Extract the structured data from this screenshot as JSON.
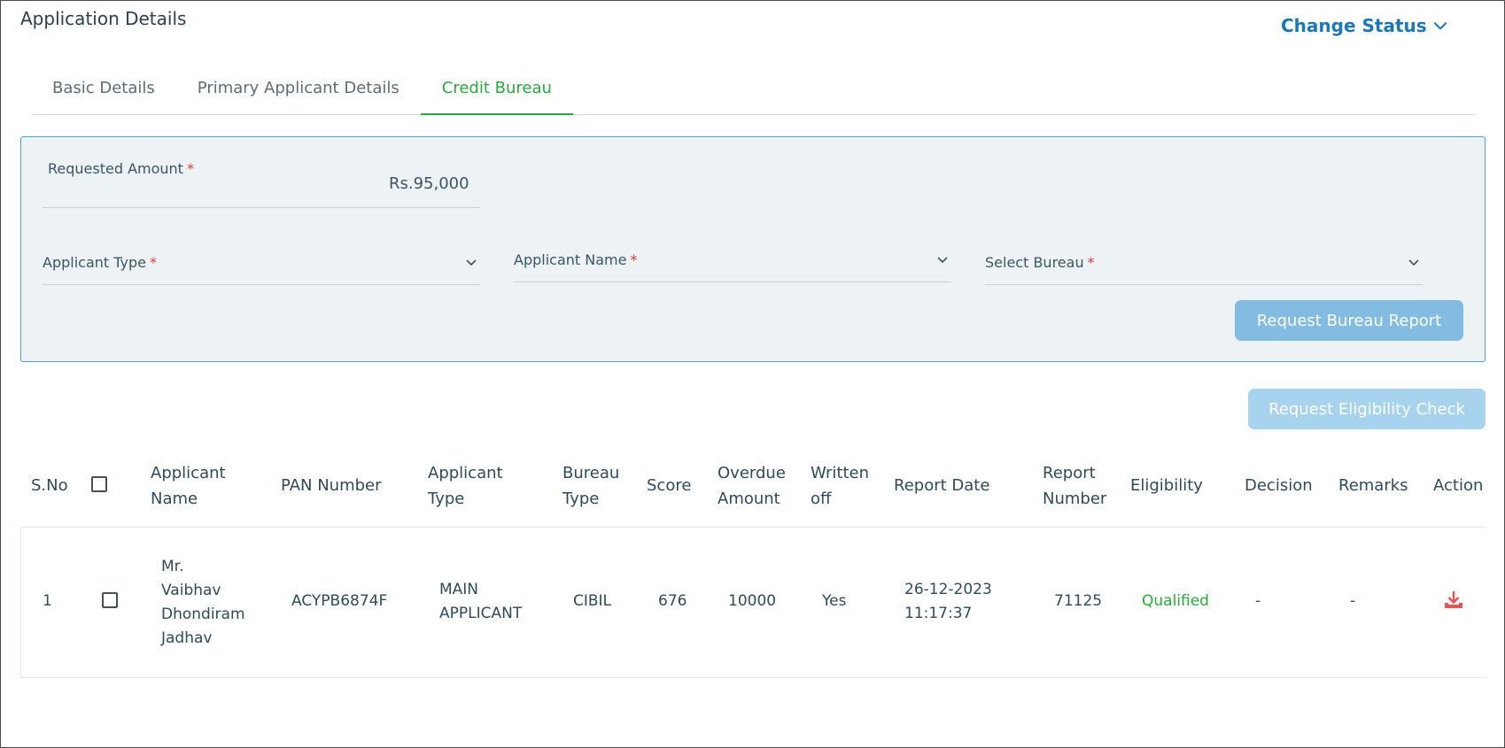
{
  "page": {
    "title": "Application Details",
    "change_status": "Change Status"
  },
  "tabs": [
    {
      "label": "Basic Details",
      "active": false
    },
    {
      "label": "Primary Applicant Details",
      "active": false
    },
    {
      "label": "Credit Bureau",
      "active": true
    }
  ],
  "form": {
    "requested_amount": {
      "label": "Requested Amount",
      "required_mark": "*",
      "value": "Rs.95,000"
    },
    "applicant_type": {
      "label": "Applicant Type",
      "required_mark": "*",
      "value": ""
    },
    "applicant_name": {
      "label": "Applicant Name",
      "required_mark": "*",
      "value": ""
    },
    "select_bureau": {
      "label": "Select Bureau",
      "required_mark": "*",
      "value": ""
    },
    "request_bureau_button": "Request Bureau Report"
  },
  "eligibility_button": "Request Eligibility Check",
  "table": {
    "headers": {
      "sno": "S.No",
      "applicant_name": [
        "Applicant",
        "Name"
      ],
      "pan": "PAN Number",
      "applicant_type": [
        "Applicant",
        "Type"
      ],
      "bureau_type": [
        "Bureau",
        "Type"
      ],
      "score": "Score",
      "overdue": [
        "Overdue",
        "Amount"
      ],
      "written_off": [
        "Written",
        "off"
      ],
      "report_date": "Report Date",
      "report_number": [
        "Report",
        "Number"
      ],
      "eligibility": "Eligibility",
      "decision": "Decision",
      "remarks": "Remarks",
      "action": "Action"
    },
    "rows": [
      {
        "sno": "1",
        "applicant_name": [
          "Mr.",
          "Vaibhav",
          "Dhondiram",
          "Jadhav"
        ],
        "pan": "ACYPB6874F",
        "applicant_type": [
          "MAIN",
          "APPLICANT"
        ],
        "bureau_type": "CIBIL",
        "score": "676",
        "overdue": "10000",
        "written_off": "Yes",
        "report_date": [
          "26-12-2023",
          "11:17:37"
        ],
        "report_number": "71125",
        "eligibility": "Qualified",
        "decision": "-",
        "remarks": "-"
      }
    ]
  },
  "colors": {
    "accent": "#1b78b8",
    "active_tab": "#2aa83b",
    "required": "#e53935",
    "button": "#82bce2",
    "download_icon": "#ef5350"
  },
  "icons": {
    "change_status": "chevron-down-icon",
    "select": "chevron-down-icon",
    "action": "download-icon"
  }
}
